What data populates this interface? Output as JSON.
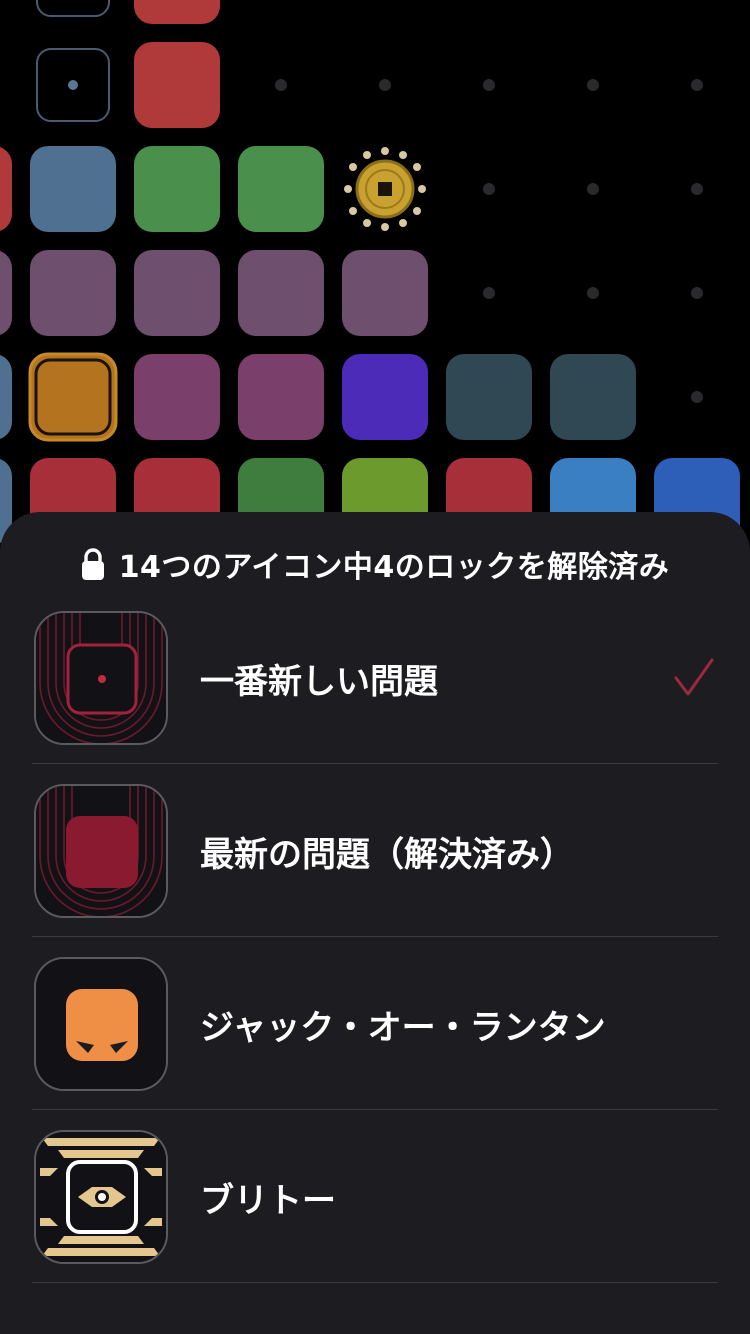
{
  "colors": {
    "background": "#000000",
    "sheet": "#1d1c21",
    "accent_check": "#9b2a3f"
  },
  "icon_sheet": {
    "header": {
      "lock_icon": "lock-icon",
      "text": "14つのアイコン中4のロックを解除済み"
    },
    "items": [
      {
        "label": "一番新しい問題",
        "selected": true,
        "icon": "newest-puzzle-icon"
      },
      {
        "label": "最新の問題（解決済み）",
        "selected": false,
        "icon": "newest-solved-icon"
      },
      {
        "label": "ジャック・オー・ランタン",
        "selected": false,
        "icon": "jack-o-lantern-icon"
      },
      {
        "label": "ブリトー",
        "selected": false,
        "icon": "burrito-icon"
      }
    ]
  },
  "background_grid": {
    "tile_colors": [
      "#b03a3a",
      "#4f7090",
      "#4a8f4c",
      "#6e4f6e",
      "#7b3f6b",
      "#4c2bb8",
      "#2f4854",
      "#a62f3a",
      "#3f7d3f",
      "#6c9a2c",
      "#3a7fc2",
      "#2e5fb8",
      "#b4741f"
    ]
  }
}
